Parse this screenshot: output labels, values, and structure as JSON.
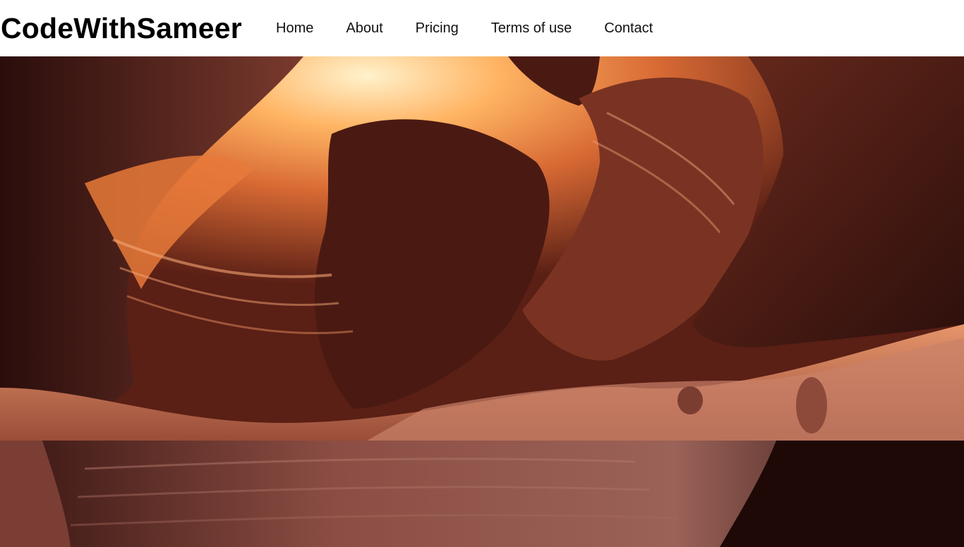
{
  "header": {
    "brand": "CodeWithSameer",
    "nav": [
      {
        "label": "Home"
      },
      {
        "label": "About"
      },
      {
        "label": "Pricing"
      },
      {
        "label": "Terms of use"
      },
      {
        "label": "Contact"
      }
    ]
  },
  "hero": {
    "image": "canyon-photo",
    "colors": {
      "dark": "#2a0f0c",
      "mid": "#8a3f2a",
      "bright": "#f2894a",
      "glow": "#ffe0a8"
    }
  }
}
